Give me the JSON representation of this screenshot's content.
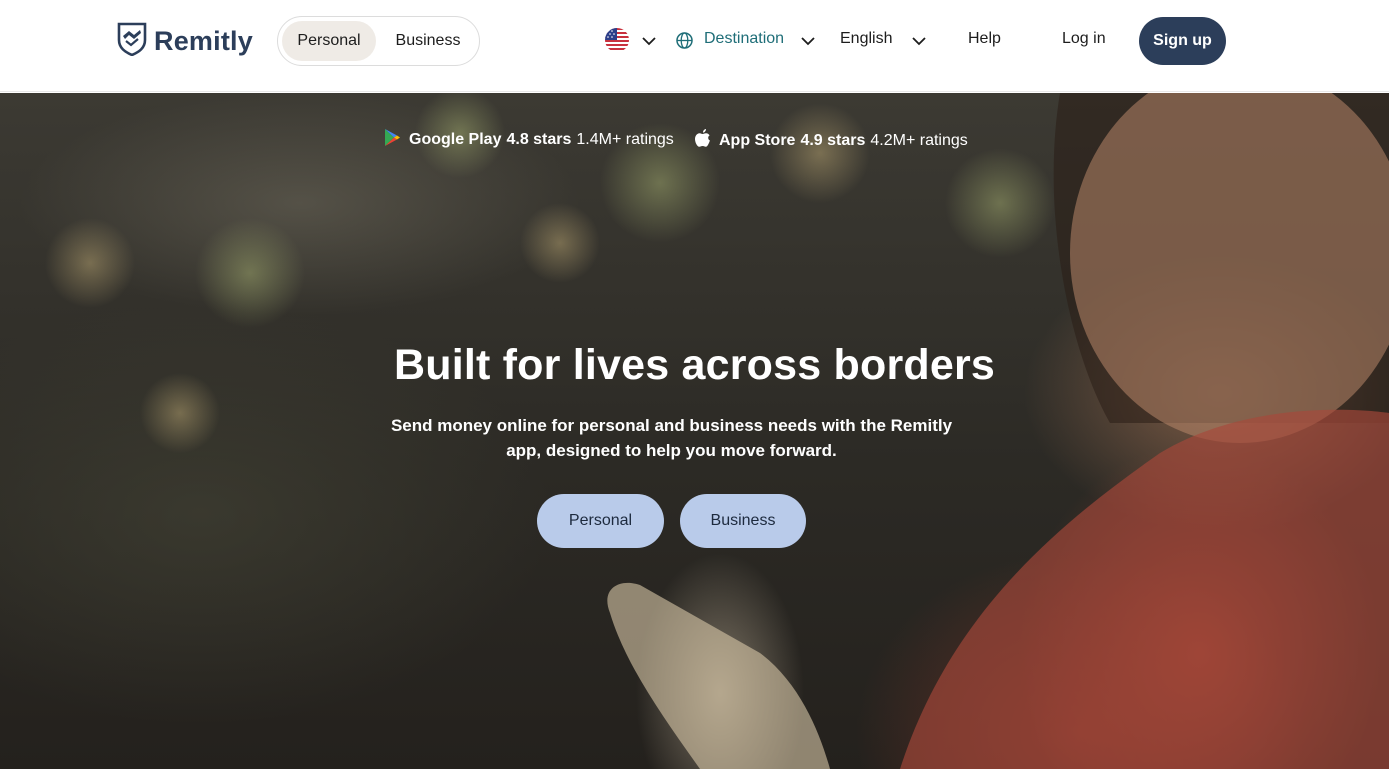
{
  "header": {
    "logo_text": "Remitly",
    "segment": {
      "personal": "Personal",
      "business": "Business",
      "selected": "Personal"
    },
    "country_flag": "us-flag-icon",
    "destination_label": "Destination",
    "language_label": "English",
    "help_label": "Help",
    "login_label": "Log in",
    "signup_label": "Sign up"
  },
  "hero": {
    "ratings": [
      {
        "store": "Google Play",
        "stars": "4.8 stars",
        "count": "1.4M+ ratings",
        "icon": "google-play-icon"
      },
      {
        "store": "App Store",
        "stars": "4.9 stars",
        "count": "4.2M+ ratings",
        "icon": "apple-icon"
      }
    ],
    "headline": "Built for lives across borders",
    "subhead": "Send money online for personal and business needs with the Remitly app, designed to help you move forward.",
    "buttons": {
      "personal": "Personal",
      "business": "Business"
    }
  },
  "colors": {
    "brand_navy": "#2c3e5a",
    "destination_teal": "#1f6e78",
    "cta_blue": "#b9cbea",
    "segment_selected": "#efebe6"
  }
}
